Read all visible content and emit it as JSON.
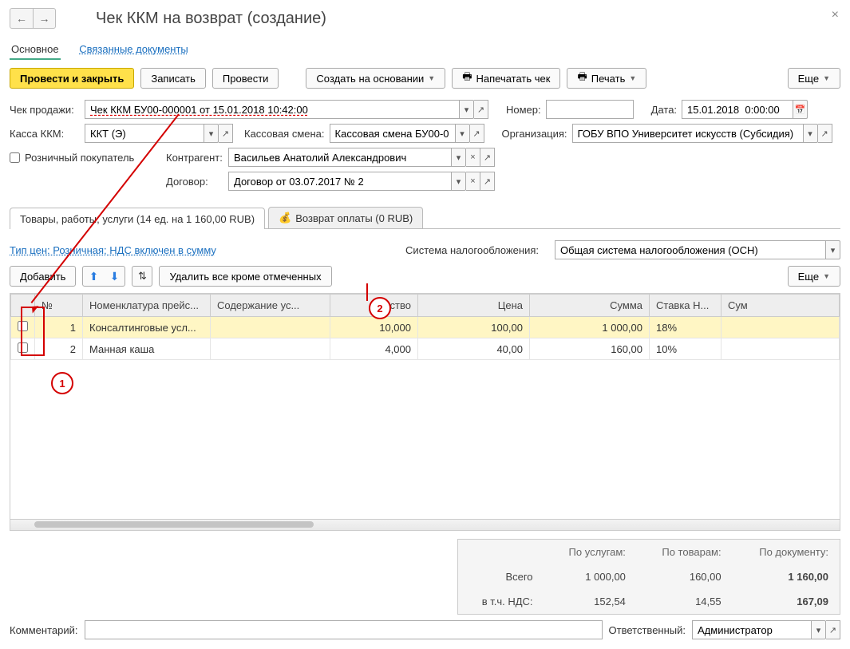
{
  "header": {
    "title": "Чек ККМ на возврат (создание)"
  },
  "view_tabs": {
    "main": "Основное",
    "related": "Связанные документы"
  },
  "toolbar": {
    "post_close": "Провести и закрыть",
    "save": "Записать",
    "post": "Провести",
    "create_based": "Создать на основании",
    "print_check": "Напечатать чек",
    "print": "Печать",
    "more": "Еще"
  },
  "fields": {
    "sale_check_lbl": "Чек продажи:",
    "sale_check_val": "Чек ККМ БУ00-000001 от 15.01.2018 10:42:00",
    "number_lbl": "Номер:",
    "number_val": "",
    "date_lbl": "Дата:",
    "date_val": "15.01.2018  0:00:00",
    "kassa_lbl": "Касса ККМ:",
    "kassa_val": "ККТ (Э)",
    "shift_lbl": "Кассовая смена:",
    "shift_val": "Кассовая смена БУ00-0",
    "org_lbl": "Организация:",
    "org_val": "ГОБУ ВПО Университет искусств (Субсидия)",
    "retail_lbl": "Розничный покупатель",
    "counterparty_lbl": "Контрагент:",
    "counterparty_val": "Васильев Анатолий Александрович",
    "contract_lbl": "Договор:",
    "contract_val": "Договор от 03.07.2017 № 2"
  },
  "sub_tabs": {
    "goods": "Товары, работы, услуги (14 ед. на 1 160,00 RUB)",
    "refund": "Возврат оплаты (0 RUB)"
  },
  "content": {
    "price_type_link": "Тип цен: Розничная; НДС включен в сумму",
    "tax_sys_lbl": "Система налогообложения:",
    "tax_sys_val": "Общая система налогообложения (ОСН)"
  },
  "grid_toolbar": {
    "add": "Добавить",
    "delete_except": "Удалить все кроме отмеченных",
    "more": "Еще"
  },
  "grid": {
    "cols": {
      "num": "№",
      "nom": "Номенклатура прейс...",
      "desc": "Содержание ус...",
      "qty": "чество",
      "price": "Цена",
      "sum": "Сумма",
      "vat": "Ставка Н...",
      "sumv": "Сум"
    },
    "rows": [
      {
        "n": "1",
        "nom": "Консалтинговые усл...",
        "desc": "",
        "qty": "10,000",
        "price": "100,00",
        "sum": "1 000,00",
        "vat": "18%"
      },
      {
        "n": "2",
        "nom": "Манная каша",
        "desc": "",
        "qty": "4,000",
        "price": "40,00",
        "sum": "160,00",
        "vat": "10%"
      }
    ]
  },
  "totals": {
    "h_services": "По услугам:",
    "h_goods": "По товарам:",
    "h_doc": "По документу:",
    "r_total": "Всего",
    "r_vat": "в т.ч. НДС:",
    "services_total": "1 000,00",
    "goods_total": "160,00",
    "doc_total": "1 160,00",
    "services_vat": "152,54",
    "goods_vat": "14,55",
    "doc_vat": "167,09"
  },
  "footer": {
    "comment_lbl": "Комментарий:",
    "comment_val": "",
    "resp_lbl": "Ответственный:",
    "resp_val": "Администратор"
  },
  "callouts": {
    "c1": "1",
    "c2": "2"
  }
}
